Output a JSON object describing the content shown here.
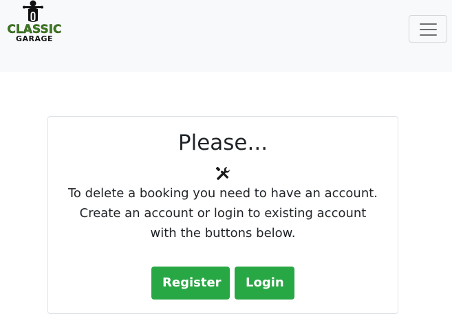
{
  "navbar": {
    "brand": {
      "line1": "CLASSIC",
      "line2": "GARAGE",
      "logo_icon": "motorcycle-rider-icon",
      "primary_color": "#3d7a1f"
    },
    "toggler_icon": "hamburger-menu-icon",
    "background": "#f8f9fa"
  },
  "card": {
    "title": "Please...",
    "icon": "tools-icon",
    "message": "To delete a booking you need to have an account. Create an account or login to existing account with the buttons below.",
    "buttons": {
      "register_label": "Register",
      "login_label": "Login",
      "color": "#28a745"
    }
  }
}
